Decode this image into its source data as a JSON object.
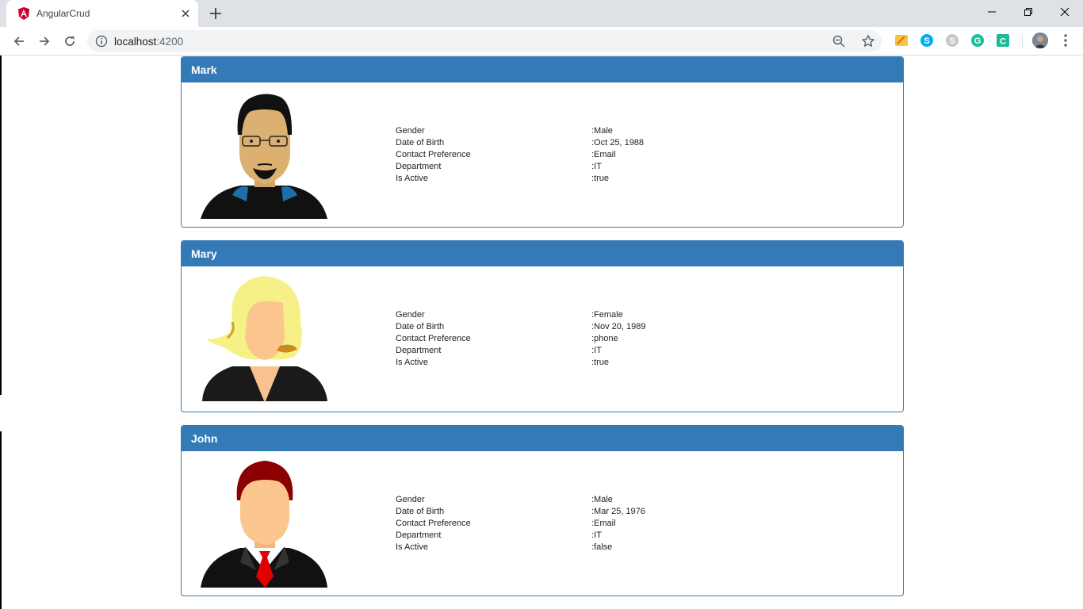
{
  "browser": {
    "tab_title": "AngularCrud",
    "url_host": "localhost",
    "url_port": ":4200"
  },
  "employees": [
    {
      "name": "Mark",
      "gender": ":Male",
      "date_of_birth": ":Oct 25, 1988",
      "contact_preference": ":Email",
      "department": ":IT",
      "is_active": ":true"
    },
    {
      "name": "Mary",
      "gender": ":Female",
      "date_of_birth": ":Nov 20, 1989",
      "contact_preference": ":phone",
      "department": ":IT",
      "is_active": ":true"
    },
    {
      "name": "John",
      "gender": ":Male",
      "date_of_birth": ":Mar 25, 1976",
      "contact_preference": ":Email",
      "department": ":IT",
      "is_active": ":false"
    }
  ],
  "labels": {
    "gender": "Gender",
    "date_of_birth": "Date of Birth",
    "contact_preference": "Contact Preference",
    "department": "Department",
    "is_active": "Is Active"
  },
  "colors": {
    "panel_primary": "#337ab7"
  }
}
